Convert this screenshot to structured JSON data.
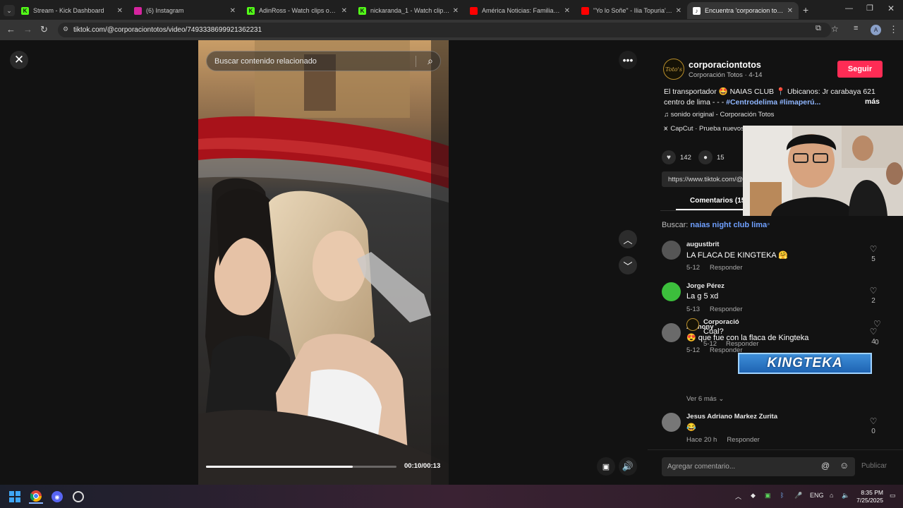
{
  "browser": {
    "tabs": [
      {
        "title": "Stream - Kick Dashboard",
        "favicon": "kick-icon",
        "color": "#53fc18"
      },
      {
        "title": "(6) Instagram",
        "favicon": "instagram-icon",
        "color": "#d6249f"
      },
      {
        "title": "AdinRoss - Watch clips on Kick",
        "favicon": "kick-icon",
        "color": "#53fc18"
      },
      {
        "title": "nickaranda_1 - Watch clips on Kick",
        "favicon": "kick-icon",
        "color": "#53fc18"
      },
      {
        "title": "América Noticias: Familia denuncia",
        "favicon": "youtube-icon",
        "color": "#ff0000"
      },
      {
        "title": "\"Yo lo Soñe\" - Ilia Topuria's Ride",
        "favicon": "youtube-icon",
        "color": "#ff0000"
      },
      {
        "title": "Encuentra 'corporacion totos'",
        "favicon": "tiktok-icon",
        "color": "#ffffff"
      }
    ],
    "url": "tiktok.com/@corporaciontotos/video/7493338699921362231"
  },
  "video": {
    "search_placeholder": "Buscar contenido relacionado",
    "time": "00:10/00:13",
    "progress_fraction": 0.77
  },
  "author": {
    "avatar_text": "Toto's",
    "username": "corporaciontotos",
    "meta": "Corporación Totos · 4-14",
    "follow_label": "Seguir"
  },
  "description": {
    "text": "El transportador 🤩 NAIAS CLUB 📍 Ubicanos: Jr carabaya 621 centro de lima - - - ",
    "hashtags": "#Centrodelima #limaperú...",
    "more": "más"
  },
  "music": "♫  sonido original - Corporación Totos",
  "capcut": "CapCut · Prueba nuevos",
  "stats": {
    "likes": "142",
    "comments": "15"
  },
  "link": "https://www.tiktok.com/@",
  "comments_tab": "Comentarios (15",
  "buscar": {
    "label": "Buscar:",
    "query": "naias night club lima"
  },
  "comments": [
    {
      "user": "augustbrit",
      "text": "LA FLACA DE KINGTEKA 🤗",
      "date": "5-12",
      "reply": "Responder",
      "likes": "5",
      "avatar_color": "#555"
    },
    {
      "user": "Jorge Pérez",
      "text": "La g 5 xd",
      "date": "5-13",
      "reply": "Responder",
      "likes": "2",
      "avatar_color": "#3cbf3c"
    },
    {
      "user": "Anthony",
      "text": "😍 que fue con la flaca de Kingteka",
      "date": "5-12",
      "reply": "Responder",
      "likes": "4",
      "avatar_color": "#6a6a6a"
    },
    {
      "user": "Jesus Adriano Markez Zurita",
      "text": "😂",
      "date": "Hace 20 h",
      "reply": "Responder",
      "likes": "0",
      "avatar_color": "#777"
    }
  ],
  "reply_comment": {
    "user": "Corporació",
    "text": "Cual?",
    "date": "5-12",
    "reply": "Responder",
    "likes": "0"
  },
  "ver_mas": "Ver 6 más ⌄",
  "comment_input": {
    "placeholder": "Agregar comentario...",
    "publish": "Publicar"
  },
  "overlay": {
    "kingteka": "KINGTEKA"
  },
  "taskbar": {
    "lang": "ENG",
    "time": "8:35 PM",
    "date": "7/25/2025"
  }
}
